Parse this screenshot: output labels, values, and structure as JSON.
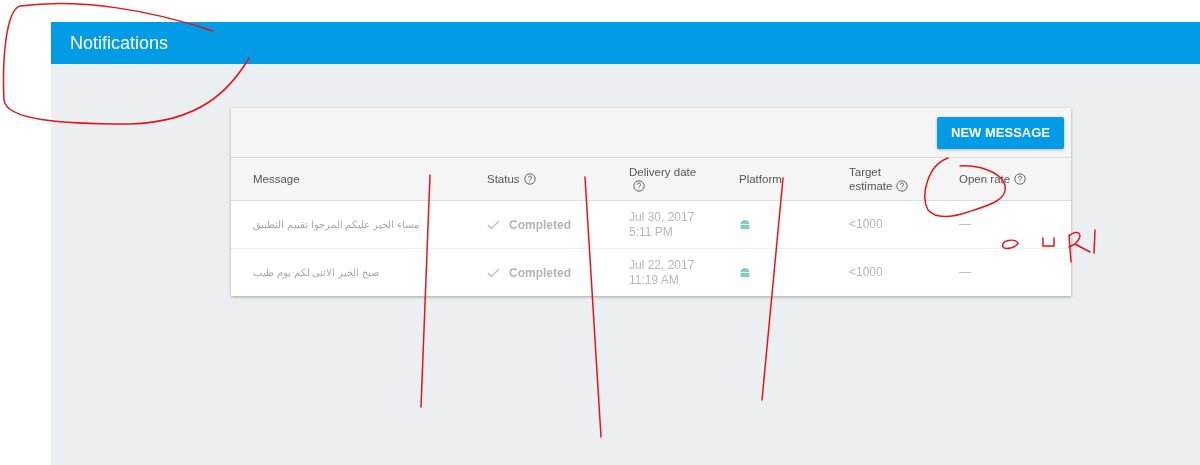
{
  "app_bar": {
    "title": "Notifications"
  },
  "toolbar": {
    "button": "NEW MESSAGE"
  },
  "table": {
    "columns": [
      {
        "label": "Message",
        "help": false
      },
      {
        "label": "Status",
        "help": true
      },
      {
        "label": "Delivery date",
        "help": true
      },
      {
        "label": "Platform",
        "help": false
      },
      {
        "label": "Target estimate",
        "help": true
      },
      {
        "label": "Open rate",
        "help": true
      }
    ],
    "rows": [
      {
        "message": "مساء الخير عليكم المرجوا تقييم التطبيق",
        "status": "Completed",
        "date": "Jul 30, 2017",
        "time": "5:11 PM",
        "target": "<1000",
        "open_rate": "—"
      },
      {
        "message": "صبح الخير الاثنى لكم يوم طيب",
        "status": "Completed",
        "date": "Jul 22, 2017",
        "time": "11:19 AM",
        "target": "<1000",
        "open_rate": "—"
      }
    ]
  }
}
